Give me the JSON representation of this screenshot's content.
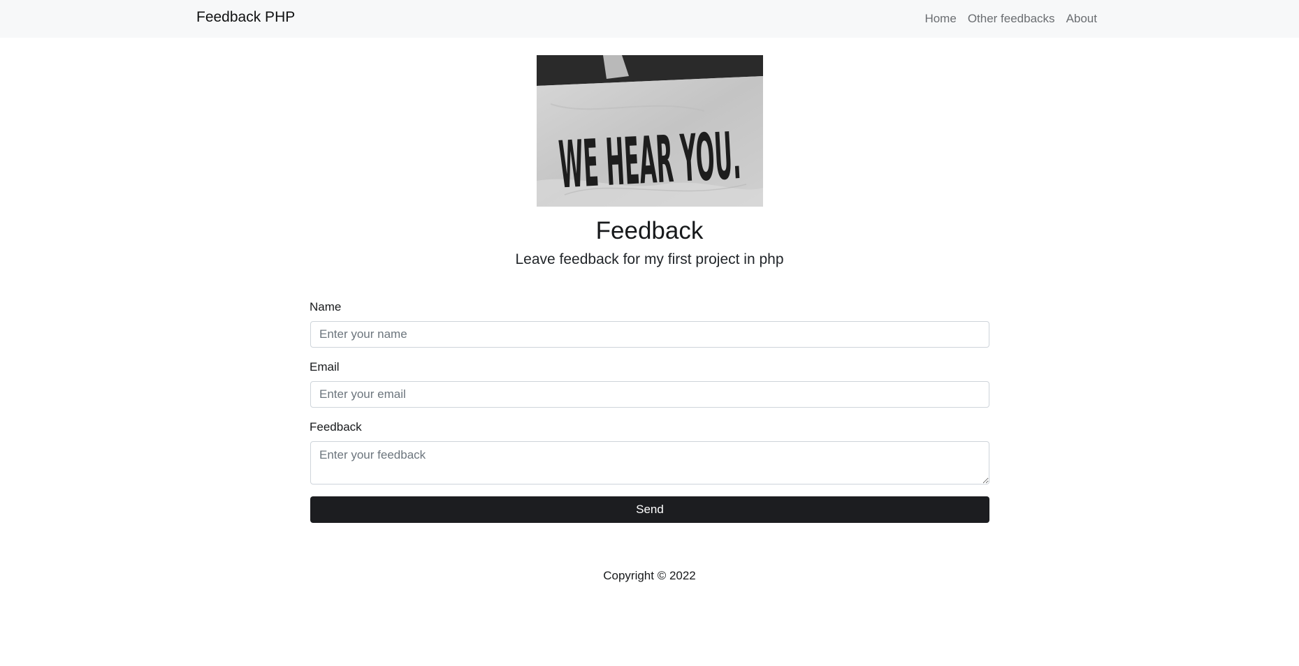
{
  "navbar": {
    "brand": "Feedback PHP",
    "links": [
      {
        "label": "Home"
      },
      {
        "label": "Other feedbacks"
      },
      {
        "label": "About"
      }
    ]
  },
  "hero": {
    "image_text": "WE HEAR YOU."
  },
  "header": {
    "title": "Feedback",
    "subtitle": "Leave feedback for my first project in php"
  },
  "form": {
    "name_label": "Name",
    "name_placeholder": "Enter your name",
    "name_value": "",
    "email_label": "Email",
    "email_placeholder": "Enter your email",
    "email_value": "",
    "feedback_label": "Feedback",
    "feedback_placeholder": "Enter your feedback",
    "feedback_value": "",
    "submit_label": "Send"
  },
  "footer": {
    "copyright": "Copyright © 2022"
  }
}
